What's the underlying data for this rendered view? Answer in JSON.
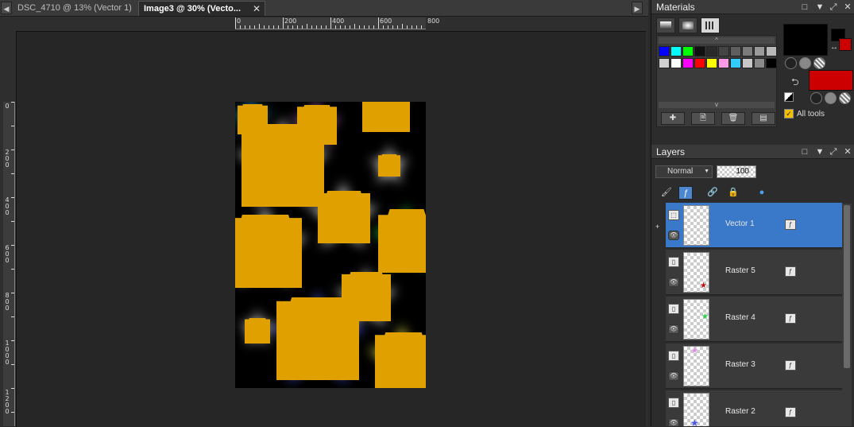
{
  "tabs": [
    {
      "label": "DSC_4710 @  13% (Vector 1)",
      "active": false
    },
    {
      "label": "Image3 @  30% (Vecto...",
      "active": true
    }
  ],
  "icons": {
    "tab_left": "◀",
    "tab_right": "▶",
    "close": "✕",
    "minimize": "□",
    "pin": "▼",
    "float": "⤢",
    "panel_close": "✕",
    "swap": "↔",
    "reset": "⮌",
    "add": "✚",
    "new": "🗎",
    "delete": "🗑",
    "props": "▤",
    "eye": "👁",
    "vector_layer": "⬚",
    "raster_layer": "▯",
    "link": "🔗",
    "lock": "🔒",
    "globe": "●",
    "brush": "🖌",
    "fx": "ƒ",
    "expand": "+"
  },
  "ruler": {
    "horizontal": [
      "0",
      "200",
      "400",
      "600",
      "800"
    ],
    "vertical": [
      "0",
      "200",
      "400",
      "600",
      "800",
      "1000",
      "1200"
    ]
  },
  "materials": {
    "title": "Materials",
    "tabs": [
      "gradient",
      "texture",
      "swatches"
    ],
    "swatch_rows": [
      [
        "#0000ff",
        "#00ffff",
        "#00ff00",
        "#111111",
        "#2a2a2a",
        "#444444",
        "#5e5e5e",
        "#7c7c7c",
        "#9a9a9a",
        "#b8b8b8"
      ],
      [
        "#d0d0d0",
        "#ffffff",
        "#ff00ff",
        "#ff0000",
        "#ffff00",
        "#ff9ae6",
        "#33ccff",
        "#c8c8c8",
        "#8a8a8a",
        "#000000"
      ]
    ],
    "foreground_color": "#000000",
    "background_color": "#cc0000",
    "all_tools_label": "All tools",
    "all_tools_checked": true
  },
  "layers": {
    "title": "Layers",
    "blend_mode": "Normal",
    "opacity": "100",
    "items": [
      {
        "name": "Vector 1",
        "selected": true,
        "type": "vector"
      },
      {
        "name": "Raster 5",
        "selected": false,
        "type": "raster"
      },
      {
        "name": "Raster 4",
        "selected": false,
        "type": "raster"
      },
      {
        "name": "Raster 3",
        "selected": false,
        "type": "raster"
      },
      {
        "name": "Raster 2",
        "selected": false,
        "type": "raster"
      }
    ]
  }
}
